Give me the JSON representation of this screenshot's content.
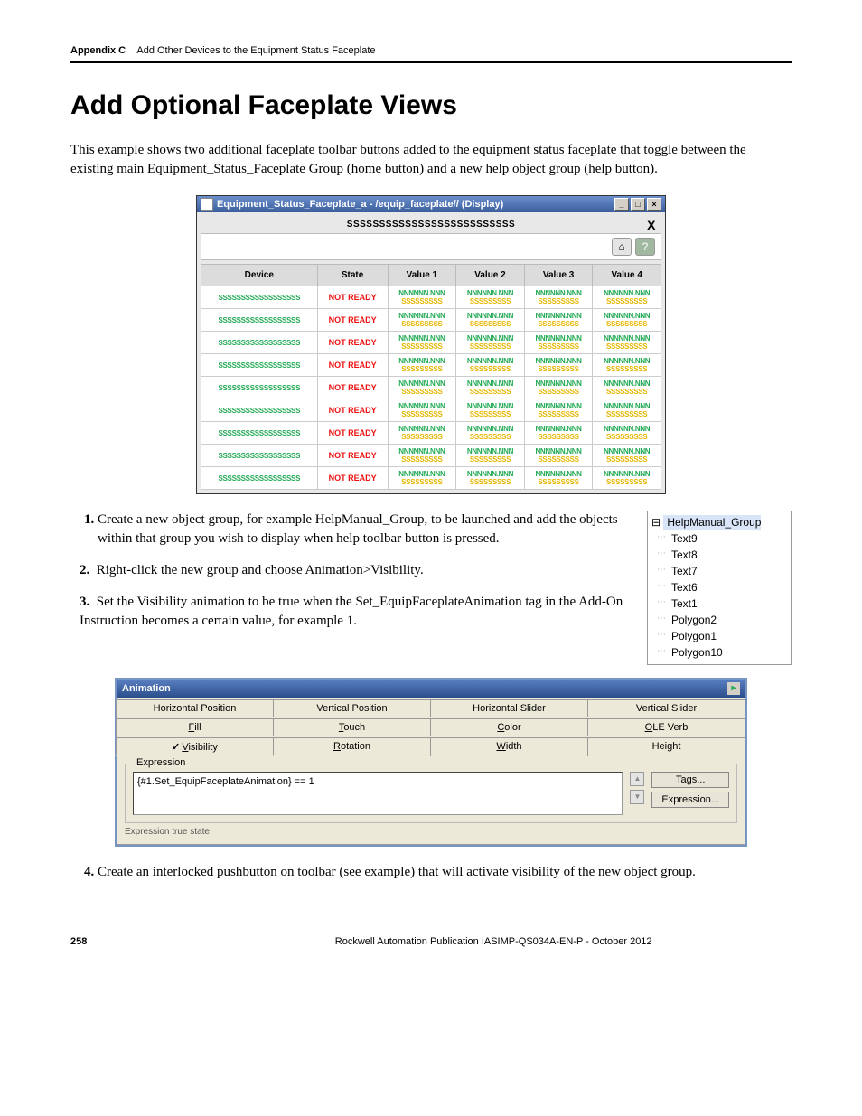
{
  "header": {
    "appendix": "Appendix C",
    "title": "Add Other Devices to the Equipment Status Faceplate"
  },
  "h1": "Add Optional Faceplate Views",
  "intro": "This example shows two additional faceplate toolbar buttons added to the equipment status faceplate that toggle between the existing main Equipment_Status_Faceplate Group (home button) and a new help object group (help button).",
  "faceplate": {
    "window_title": "Equipment_Status_Faceplate_a - /equip_faceplate// (Display)",
    "placeholder_bar": "SSSSSSSSSSSSSSSSSSSSSSSSSS",
    "columns": [
      "Device",
      "State",
      "Value 1",
      "Value 2",
      "Value 3",
      "Value 4"
    ],
    "device_ph": "SSSSSSSSSSSSSSSSSS",
    "state_ph": "NOT READY",
    "val_top": "NNNNNN.NNN",
    "val_bot": "SSSSSSSSS",
    "row_count": 9
  },
  "steps": {
    "s1": "Create a new object group, for example HelpManual_Group, to be launched and add the objects within that group you wish to display when help toolbar button is pressed.",
    "s2": "Right-click the new group and choose Animation>Visibility.",
    "s3": "Set the Visibility animation to be true when the Set_EquipFaceplateAnimation tag in the Add-On Instruction becomes a certain value, for example 1.",
    "s4": "Create an interlocked pushbutton on toolbar (see example) that will activate visibility of the new object group."
  },
  "tree": {
    "root": "HelpManual_Group",
    "items": [
      "Text9",
      "Text8",
      "Text7",
      "Text6",
      "Text1",
      "Polygon2",
      "Polygon1",
      "Polygon10"
    ]
  },
  "animation": {
    "title": "Animation",
    "tabs_row1": [
      "Horizontal Position",
      "Vertical Position",
      "Horizontal Slider",
      "Vertical Slider"
    ],
    "tabs_row2": [
      "Fill",
      "Touch",
      "Color",
      "OLE Verb"
    ],
    "tabs_row3": [
      "Visibility",
      "Rotation",
      "Width",
      "Height"
    ],
    "tabs_row2_u": [
      "F",
      "T",
      "C",
      "O"
    ],
    "tabs_row3_u": [
      "V",
      "R",
      "W",
      ""
    ],
    "expression_label": "Expression",
    "expression": "{#1.Set_EquipFaceplateAnimation} == 1",
    "btn_tags": "Tags...",
    "btn_expr": "Expression...",
    "trunc": "Expression true state"
  },
  "footer": {
    "page": "258",
    "pub": "Rockwell Automation Publication IASIMP-QS034A-EN-P - ",
    "date": "October 2012"
  }
}
